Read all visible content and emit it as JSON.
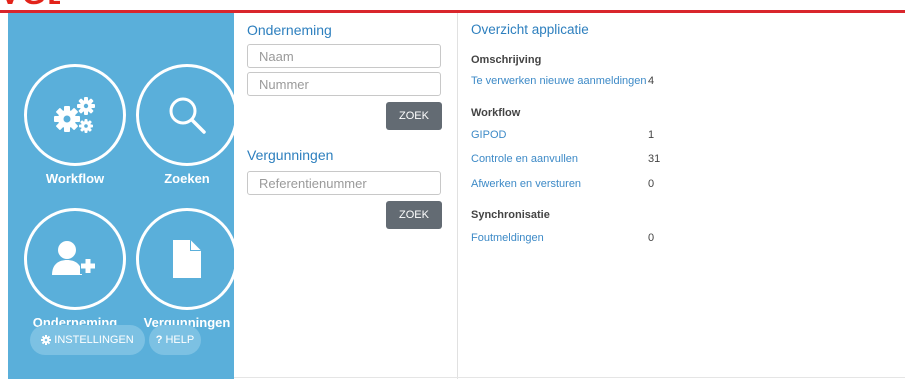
{
  "brand": {
    "logo_text": "VGB"
  },
  "tiles": {
    "workflow": "Workflow",
    "zoeken": "Zoeken",
    "onderneming": "Onderneming",
    "vergunningen": "Vergunningen"
  },
  "buttons": {
    "instellingen": "INSTELLINGEN",
    "help": "HELP",
    "help_mark": "?"
  },
  "onderneming_form": {
    "heading": "Onderneming",
    "naam_placeholder": "Naam",
    "nummer_placeholder": "Nummer",
    "search_label": "ZOEK"
  },
  "vergunningen_form": {
    "heading": "Vergunningen",
    "referentie_placeholder": "Referentienummer",
    "search_label": "ZOEK"
  },
  "overview": {
    "title": "Overzicht applicatie",
    "omschrijving": {
      "heading": "Omschrijving",
      "items": [
        {
          "label": "Te verwerken nieuwe aanmeldingen",
          "count": "4"
        }
      ]
    },
    "workflow": {
      "heading": "Workflow",
      "items": [
        {
          "label": "GIPOD",
          "count": "1"
        },
        {
          "label": "Controle en aanvullen",
          "count": "31"
        },
        {
          "label": "Afwerken en versturen",
          "count": "0"
        }
      ]
    },
    "synchronisatie": {
      "heading": "Synchronisatie",
      "items": [
        {
          "label": "Foutmeldingen",
          "count": "0"
        }
      ]
    }
  },
  "colors": {
    "brand_red": "#d9262c",
    "panel_blue": "#5aafda",
    "link_blue": "#3d8ac7",
    "button_gray": "#636b73"
  },
  "icons": [
    "gears-icon",
    "search-icon",
    "add-user-icon",
    "document-icon",
    "gear-icon"
  ]
}
